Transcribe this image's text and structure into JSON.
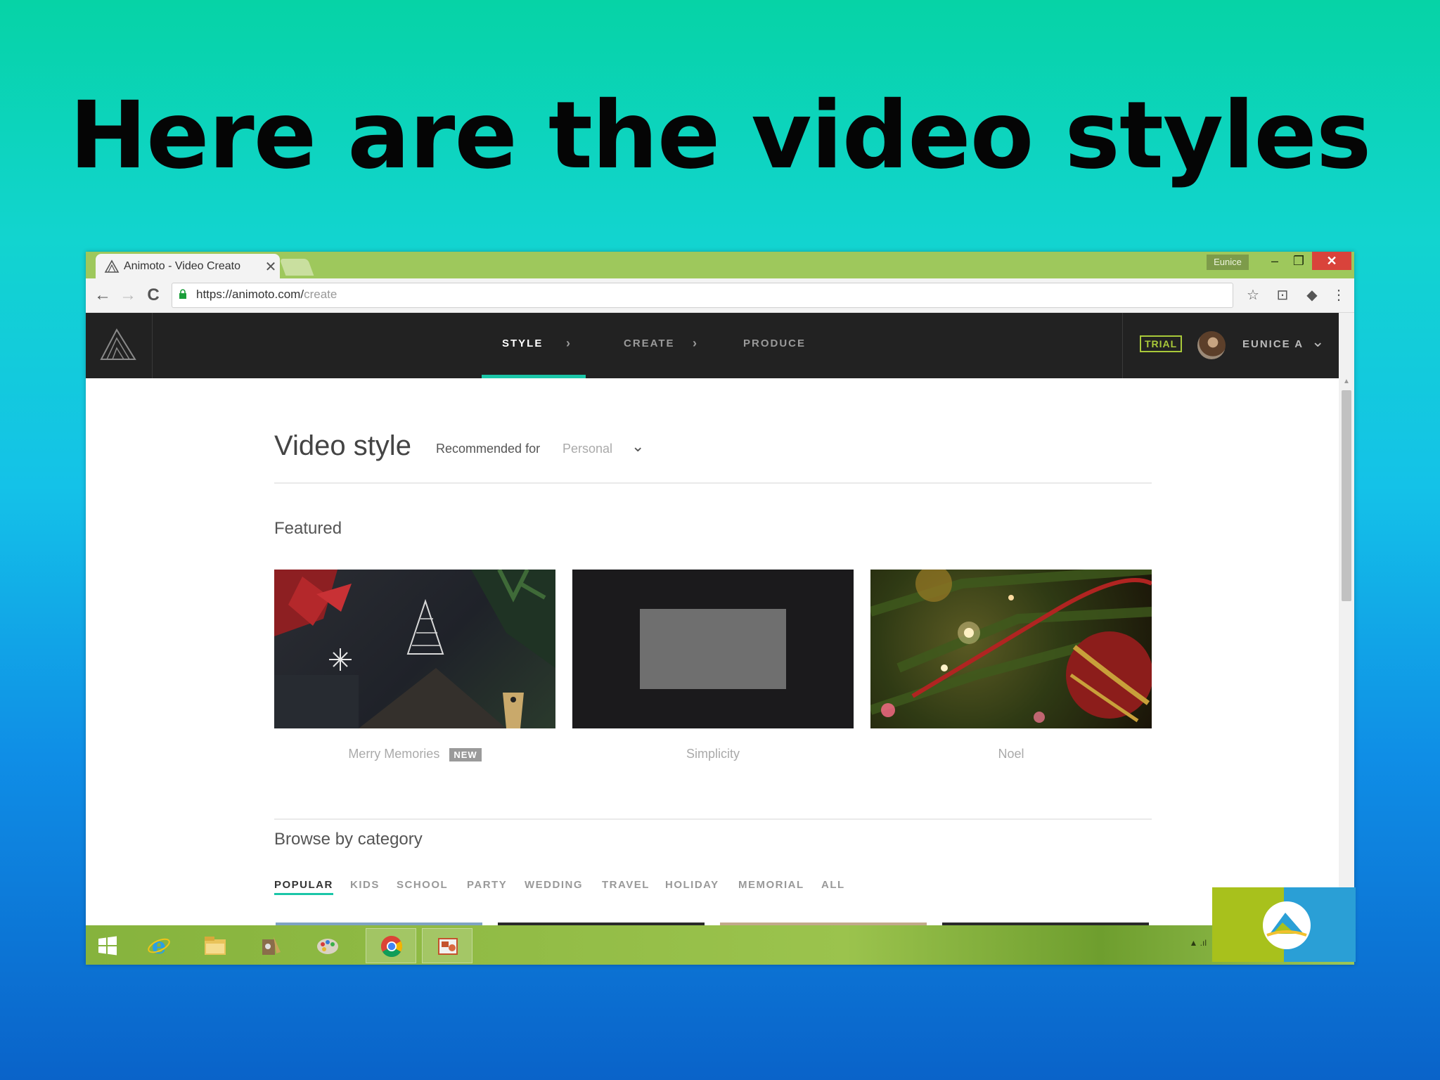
{
  "slide": {
    "title": "Here are the video styles"
  },
  "browser": {
    "tab_title": "Animoto - Video Creato",
    "tab_close": "✕",
    "user_chip": "Eunice",
    "window_controls": {
      "minimize": "–",
      "restore": "❐",
      "close": "✕"
    },
    "nav": {
      "back": "←",
      "forward": "→",
      "reload": "C"
    },
    "url_scheme_host": "https://animoto.com/",
    "url_path": "create",
    "toolbar_icons": [
      "star-icon",
      "extension-icon",
      "extension-icon-2",
      "menu-icon"
    ],
    "toolbar_glyphs": {
      "star": "☆",
      "ext1": "⊡",
      "ext2": "◆",
      "menu": "⋮"
    }
  },
  "app": {
    "steps": [
      {
        "label": "STYLE",
        "active": true
      },
      {
        "label": "CREATE",
        "active": false
      },
      {
        "label": "PRODUCE",
        "active": false
      }
    ],
    "step_separator": "›",
    "trial_badge": "TRIAL",
    "account_name": "EUNICE A",
    "account_chevron": "⌄"
  },
  "page": {
    "heading": "Video style",
    "recommended_label": "Recommended for",
    "recommended_value": "Personal",
    "recommended_chevron": "⌄",
    "featured_label": "Featured",
    "featured": [
      {
        "name": "Merry Memories",
        "badge": "NEW"
      },
      {
        "name": "Simplicity",
        "badge": ""
      },
      {
        "name": "Noel",
        "badge": ""
      }
    ],
    "browse_label": "Browse by category",
    "categories": [
      {
        "label": "POPULAR",
        "active": true
      },
      {
        "label": "KIDS",
        "active": false
      },
      {
        "label": "SCHOOL",
        "active": false
      },
      {
        "label": "PARTY",
        "active": false
      },
      {
        "label": "WEDDING",
        "active": false
      },
      {
        "label": "TRAVEL",
        "active": false
      },
      {
        "label": "HOLIDAY",
        "active": false
      },
      {
        "label": "MEMORIAL",
        "active": false
      },
      {
        "label": "ALL",
        "active": false
      }
    ]
  },
  "taskbar": {
    "items": [
      "start-icon",
      "internet-explorer-icon",
      "file-explorer-icon",
      "paint-app-icon",
      "paint-palette-icon",
      "chrome-icon",
      "powerpoint-icon"
    ],
    "tray_text": "▲ .ıl"
  },
  "colors": {
    "accent": "#1bc6a8",
    "header_bg": "#222222",
    "trial": "#a9c93a",
    "chrome_frame": "#9ec85c",
    "close_button": "#d9433b"
  }
}
